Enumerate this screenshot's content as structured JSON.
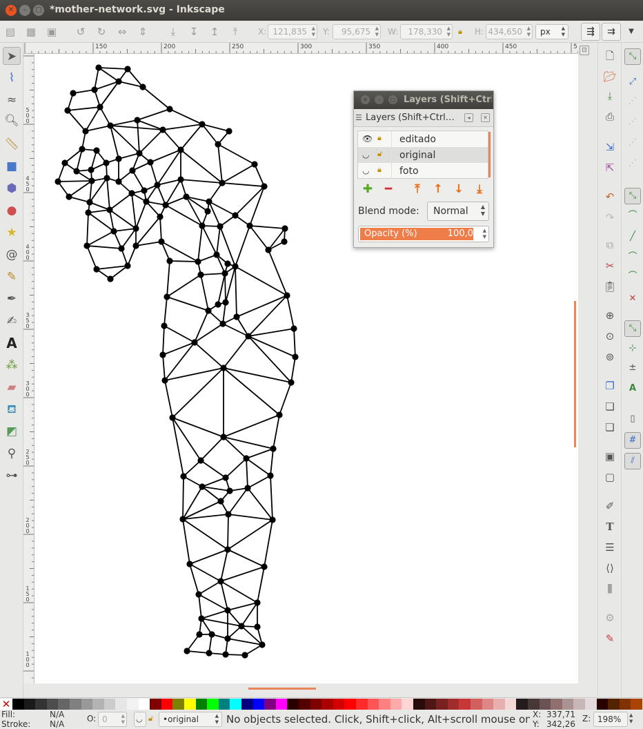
{
  "window": {
    "title": "*mother-network.svg - Inkscape",
    "controls": [
      "close",
      "minimize",
      "maximize"
    ]
  },
  "toolbar": {
    "x_label": "X:",
    "x_value": "121,835",
    "y_label": "Y:",
    "y_value": "95,675",
    "w_label": "W:",
    "w_value": "178,330",
    "h_label": "H:",
    "h_value": "434,650",
    "unit": "px"
  },
  "ruler": {
    "h_labels": [
      "150",
      "200",
      "250",
      "300",
      "350",
      "400",
      "450",
      "5"
    ],
    "v_labels": [
      "5\n0\n0",
      "4\n5\n0",
      "4\n0\n0",
      "3\n5\n0",
      "3\n0\n0",
      "2\n5\n0",
      "2\n0\n0",
      "1\n5\n0",
      "1\n0\n0"
    ]
  },
  "tools": [
    {
      "name": "selector-tool",
      "icon": "arrow-icon",
      "active": true
    },
    {
      "name": "node-tool",
      "icon": "node-icon"
    },
    {
      "name": "tweak-tool",
      "icon": "tweak-icon"
    },
    {
      "name": "zoom-tool",
      "icon": "magnifier-icon"
    },
    {
      "name": "measure-tool",
      "icon": "ruler-icon"
    },
    {
      "name": "rectangle-tool",
      "icon": "rectangle-icon"
    },
    {
      "name": "3d-box-tool",
      "icon": "cube-icon"
    },
    {
      "name": "ellipse-tool",
      "icon": "circle-icon"
    },
    {
      "name": "star-tool",
      "icon": "star-icon"
    },
    {
      "name": "spiral-tool",
      "icon": "spiral-icon"
    },
    {
      "name": "pencil-tool",
      "icon": "pencil-icon"
    },
    {
      "name": "pen-tool",
      "icon": "pen-icon"
    },
    {
      "name": "calligraphy-tool",
      "icon": "calligraphy-icon"
    },
    {
      "name": "text-tool",
      "icon": "text-icon"
    },
    {
      "name": "spray-tool",
      "icon": "spray-icon"
    },
    {
      "name": "eraser-tool",
      "icon": "eraser-icon"
    },
    {
      "name": "paint-bucket-tool",
      "icon": "bucket-icon"
    },
    {
      "name": "gradient-tool",
      "icon": "gradient-icon"
    },
    {
      "name": "dropper-tool",
      "icon": "dropper-icon"
    },
    {
      "name": "connector-tool",
      "icon": "connector-icon"
    }
  ],
  "layers_dialog": {
    "window_title": "Layers (Shift+Ctrl+L)",
    "tab_label": "Layers (Shift+Ctrl…",
    "layers": [
      {
        "name": "editado",
        "visible": true,
        "locked": true,
        "selected": false
      },
      {
        "name": "original",
        "visible": false,
        "locked": false,
        "selected": true
      },
      {
        "name": "foto",
        "visible": false,
        "locked": true,
        "selected": false
      }
    ],
    "blend_label": "Blend mode:",
    "blend_value": "Normal",
    "opacity_label": "Opacity (%)",
    "opacity_value": "100,0",
    "opacity_fraction": 1.0
  },
  "status": {
    "fill_label": "Fill:",
    "fill_value": "N/A",
    "stroke_label": "Stroke:",
    "stroke_value": "N/A",
    "o_label": "O:",
    "o_value": "0",
    "layer_select": "•original",
    "message": "No objects selected. Click, Shift+click, Alt+scroll mouse on top o...",
    "x_label": "X:",
    "x_value": "337,71",
    "y_label": "Y:",
    "y_value": "342,26",
    "z_label": "Z:",
    "zoom_value": "198%"
  },
  "palette": [
    "#000000",
    "#1a1a1a",
    "#333333",
    "#4d4d4d",
    "#666666",
    "#808080",
    "#999999",
    "#b3b3b3",
    "#cccccc",
    "#e6e6e6",
    "#f2f2f2",
    "#ffffff",
    "#800000",
    "#ff0000",
    "#808000",
    "#ffff00",
    "#008000",
    "#00ff00",
    "#008080",
    "#00ffff",
    "#000080",
    "#0000ff",
    "#800080",
    "#ff00ff",
    "#2b0000",
    "#550000",
    "#800000",
    "#aa0000",
    "#d40000",
    "#ff0000",
    "#ff2a2a",
    "#ff5555",
    "#ff8080",
    "#ffaaaa",
    "#ffd5d5",
    "#280b0b",
    "#501616",
    "#782121",
    "#a02c2c",
    "#c83737",
    "#d35f5f",
    "#de8787",
    "#e9afaf",
    "#f4d7d7",
    "#241c1c",
    "#483737",
    "#6c5353",
    "#916f6f",
    "#ac9393",
    "#c8b7b7",
    "#e3dbdb",
    "#280000",
    "#552200",
    "#803300",
    "#aa4400"
  ]
}
